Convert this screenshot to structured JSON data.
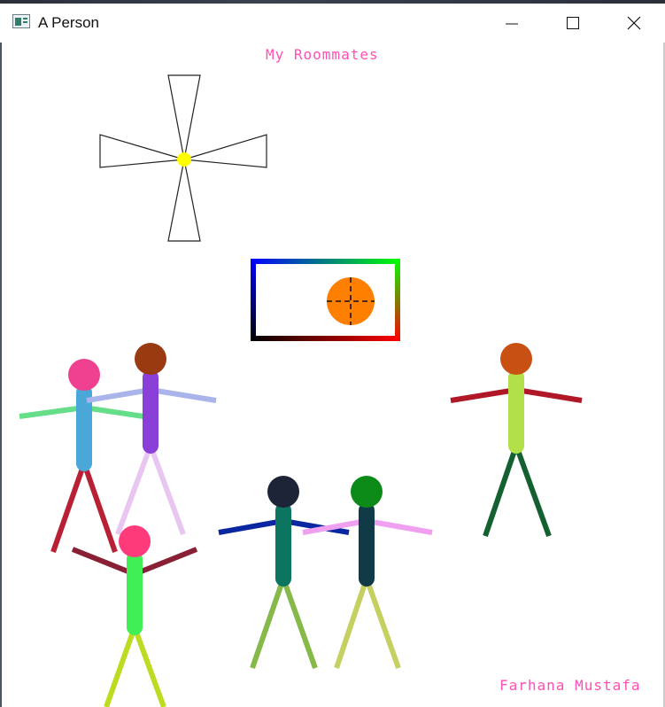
{
  "window": {
    "title": "A Person",
    "controls": [
      "minimize",
      "maximize",
      "close"
    ]
  },
  "canvas": {
    "heading": "My Roommates",
    "signature": "Farhana Mustafa",
    "text_color": "#ff4fb4",
    "pinwheel_center_color": "#ffff00",
    "ball_color": "#ff8000",
    "frame_gradient": {
      "top_left": "#0000ff",
      "top_right": "#00ff00",
      "bottom_left": "#000000",
      "bottom_right": "#ff0000"
    },
    "stick_figures": [
      {
        "head": "#f04090",
        "body": "#4aa8d8",
        "arms": "#66dd88",
        "legs": "#b82035"
      },
      {
        "head": "#9a3a10",
        "body": "#8a40d8",
        "arms": "#a8b4ea",
        "legs": "#e8c6f0"
      },
      {
        "head": "#ff3a7a",
        "body": "#40ee55",
        "arms": "#8a2035",
        "legs": "#bcdc22"
      },
      {
        "head": "#1e2438",
        "body": "#0b7560",
        "arms": "#0a26a0",
        "legs": "#86b84a"
      },
      {
        "head": "#0c8a18",
        "body": "#103a46",
        "arms": "#f0a0f0",
        "legs": "#c6d060"
      },
      {
        "head": "#c85012",
        "body": "#b2e048",
        "arms": "#b01828",
        "legs": "#156030"
      }
    ]
  }
}
